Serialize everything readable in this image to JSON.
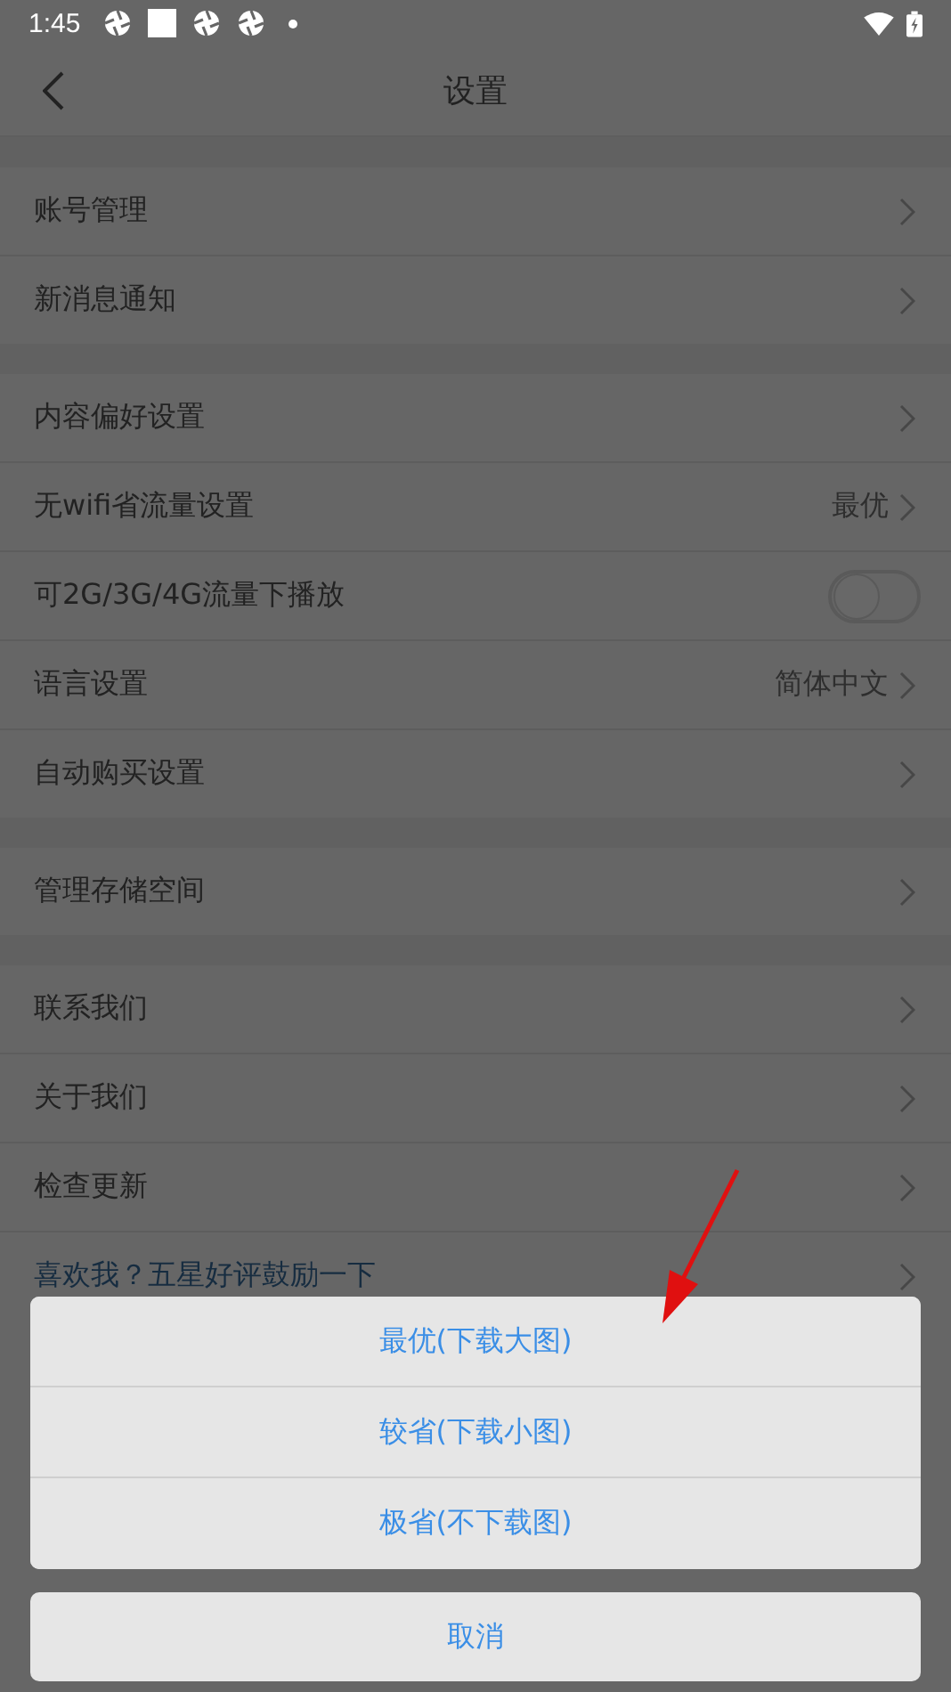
{
  "status_bar": {
    "time": "1:45"
  },
  "header": {
    "title": "设置"
  },
  "sections": [
    [
      {
        "kind": "chevron",
        "label": "账号管理"
      },
      {
        "kind": "chevron",
        "label": "新消息通知"
      }
    ],
    [
      {
        "kind": "chevron",
        "label": "内容偏好设置"
      },
      {
        "kind": "value",
        "label": "无wifi省流量设置",
        "value": "最优"
      },
      {
        "kind": "switch",
        "label": "可2G/3G/4G流量下播放",
        "on": false
      },
      {
        "kind": "value",
        "label": "语言设置",
        "value": "简体中文"
      },
      {
        "kind": "chevron",
        "label": "自动购买设置"
      }
    ],
    [
      {
        "kind": "chevron",
        "label": "管理存储空间"
      }
    ],
    [
      {
        "kind": "chevron",
        "label": "联系我们"
      },
      {
        "kind": "chevron",
        "label": "关于我们"
      },
      {
        "kind": "chevron",
        "label": "检查更新"
      },
      {
        "kind": "link",
        "label": "喜欢我？五星好评鼓励一下"
      }
    ]
  ],
  "action_sheet": {
    "options": [
      "最优(下载大图)",
      "较省(下载小图)",
      "极省(不下载图)"
    ],
    "cancel": "取消"
  },
  "annotations": [
    {
      "kind": "arrow"
    }
  ]
}
